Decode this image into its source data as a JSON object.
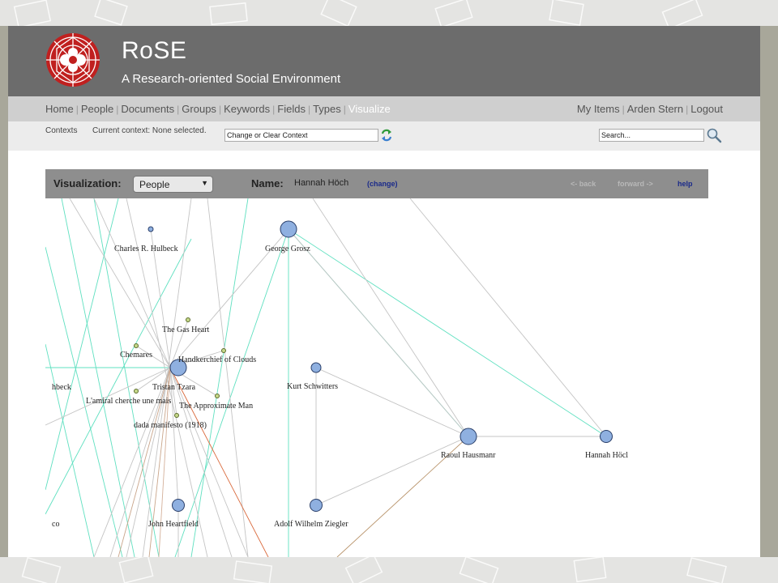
{
  "site": {
    "title": "RoSE",
    "subtitle": "A Research-oriented Social Environment"
  },
  "nav": {
    "left": [
      "Home",
      "People",
      "Documents",
      "Groups",
      "Keywords",
      "Fields",
      "Types",
      "Visualize"
    ],
    "active": "Visualize",
    "right": [
      "My Items",
      "Arden Stern",
      "Logout"
    ]
  },
  "context": {
    "label": "Contexts",
    "current": "Current context: None selected.",
    "input_value": "Change or Clear Context",
    "search_value": "Search..."
  },
  "viz": {
    "label": "Visualization:",
    "selected": "People",
    "name_label": "Name:",
    "name_value": "Hannah Höch",
    "change": "(change)",
    "back": "<- back",
    "forward": "forward ->",
    "help": "help"
  },
  "graph": {
    "nodes": [
      {
        "label": "Charles R. Hulbeck",
        "kind": "person-small"
      },
      {
        "label": "George Grosz",
        "kind": "person"
      },
      {
        "label": "The Gas Heart",
        "kind": "work"
      },
      {
        "label": "Chemares",
        "kind": "work"
      },
      {
        "label": "Handkerchief of Clouds",
        "kind": "work"
      },
      {
        "label": "Tristan Tzara",
        "kind": "person"
      },
      {
        "label": "hbeck",
        "kind": "label-only"
      },
      {
        "label": "L'amiral cherche une mais",
        "kind": "work"
      },
      {
        "label": "The Approximate Man",
        "kind": "work"
      },
      {
        "label": "dada manifesto (1918)",
        "kind": "work"
      },
      {
        "label": "Kurt Schwitters",
        "kind": "person-small"
      },
      {
        "label": "Raoul Hausmanr",
        "kind": "person"
      },
      {
        "label": "Hannah Höcl",
        "kind": "person"
      },
      {
        "label": "John Heartfield",
        "kind": "person"
      },
      {
        "label": "Adolf Wilhelm Ziegler",
        "kind": "person"
      },
      {
        "label": "co",
        "kind": "label-only"
      }
    ]
  },
  "colors": {
    "header_bg": "#6c6c6c",
    "nav_bg": "#cfcfcf",
    "person_node": "#8fb0e0",
    "work_node": "#c6d98a",
    "edge_teal": "#5fe0c0",
    "edge_gray": "#bdbdbd",
    "edge_brown": "#b8936a",
    "edge_red": "#d9683a",
    "link_blue": "#1a2a8a"
  }
}
